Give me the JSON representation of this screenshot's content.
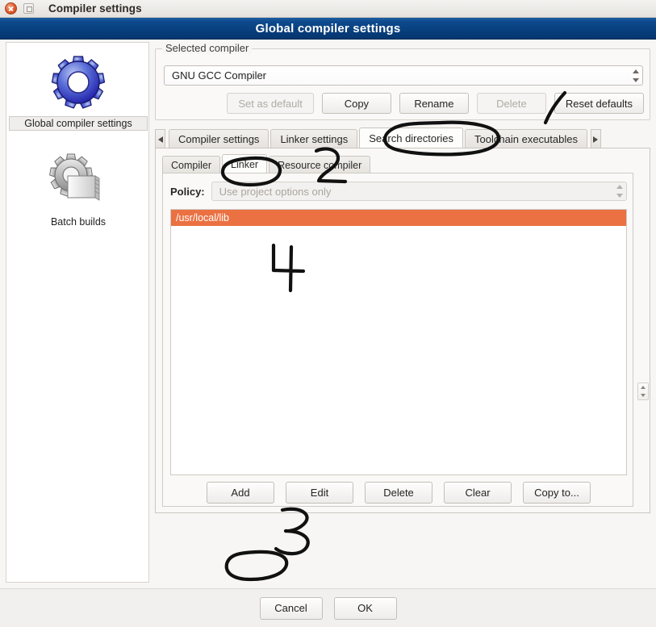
{
  "window": {
    "title": "Compiler settings",
    "close_icon": "close-icon",
    "maximize_icon": "maximize-icon"
  },
  "banner": {
    "title": "Global compiler settings"
  },
  "sidebar": {
    "items": [
      {
        "label": "Global compiler settings",
        "icon": "blue-gear-icon",
        "selected": true
      },
      {
        "label": "Batch builds",
        "icon": "grey-gear-documents-icon",
        "selected": false
      }
    ]
  },
  "selected_compiler": {
    "legend": "Selected compiler",
    "value": "GNU GCC Compiler",
    "buttons": [
      {
        "label": "Set as default",
        "enabled": false
      },
      {
        "label": "Copy",
        "enabled": true
      },
      {
        "label": "Rename",
        "enabled": true
      },
      {
        "label": "Delete",
        "enabled": false
      },
      {
        "label": "Reset defaults",
        "enabled": true
      }
    ]
  },
  "main_tabs": {
    "scroll_left_icon": "triangle-left-icon",
    "scroll_right_icon": "triangle-right-icon",
    "items": [
      {
        "label": "Compiler settings",
        "active": false
      },
      {
        "label": "Linker settings",
        "active": false
      },
      {
        "label": "Search directories",
        "active": true
      },
      {
        "label": "Toolchain executables",
        "active": false
      }
    ]
  },
  "sub_tabs": {
    "items": [
      {
        "label": "Compiler",
        "active": false
      },
      {
        "label": "Linker",
        "active": true
      },
      {
        "label": "Resource compiler",
        "active": false
      }
    ]
  },
  "policy": {
    "label": "Policy:",
    "value": "Use project options only",
    "enabled": false
  },
  "directories": {
    "items": [
      {
        "path": "/usr/local/lib",
        "selected": true
      }
    ],
    "selection_color": "#eb7142"
  },
  "list_actions": [
    {
      "label": "Add"
    },
    {
      "label": "Edit"
    },
    {
      "label": "Delete"
    },
    {
      "label": "Clear"
    },
    {
      "label": "Copy to..."
    }
  ],
  "footer_buttons": [
    {
      "label": "Cancel"
    },
    {
      "label": "OK"
    }
  ],
  "annotations": [
    {
      "kind": "ellipse",
      "target": "Search directories"
    },
    {
      "kind": "stroke",
      "target": "Reset defaults"
    },
    {
      "kind": "ellipse",
      "target": "Linker"
    },
    {
      "kind": "digit",
      "text": "2",
      "target": "Resource compiler"
    },
    {
      "kind": "digit",
      "text": "4",
      "target": "directory list"
    },
    {
      "kind": "digit",
      "text": "3",
      "target": "Add"
    },
    {
      "kind": "ellipse",
      "target": "Add"
    }
  ]
}
